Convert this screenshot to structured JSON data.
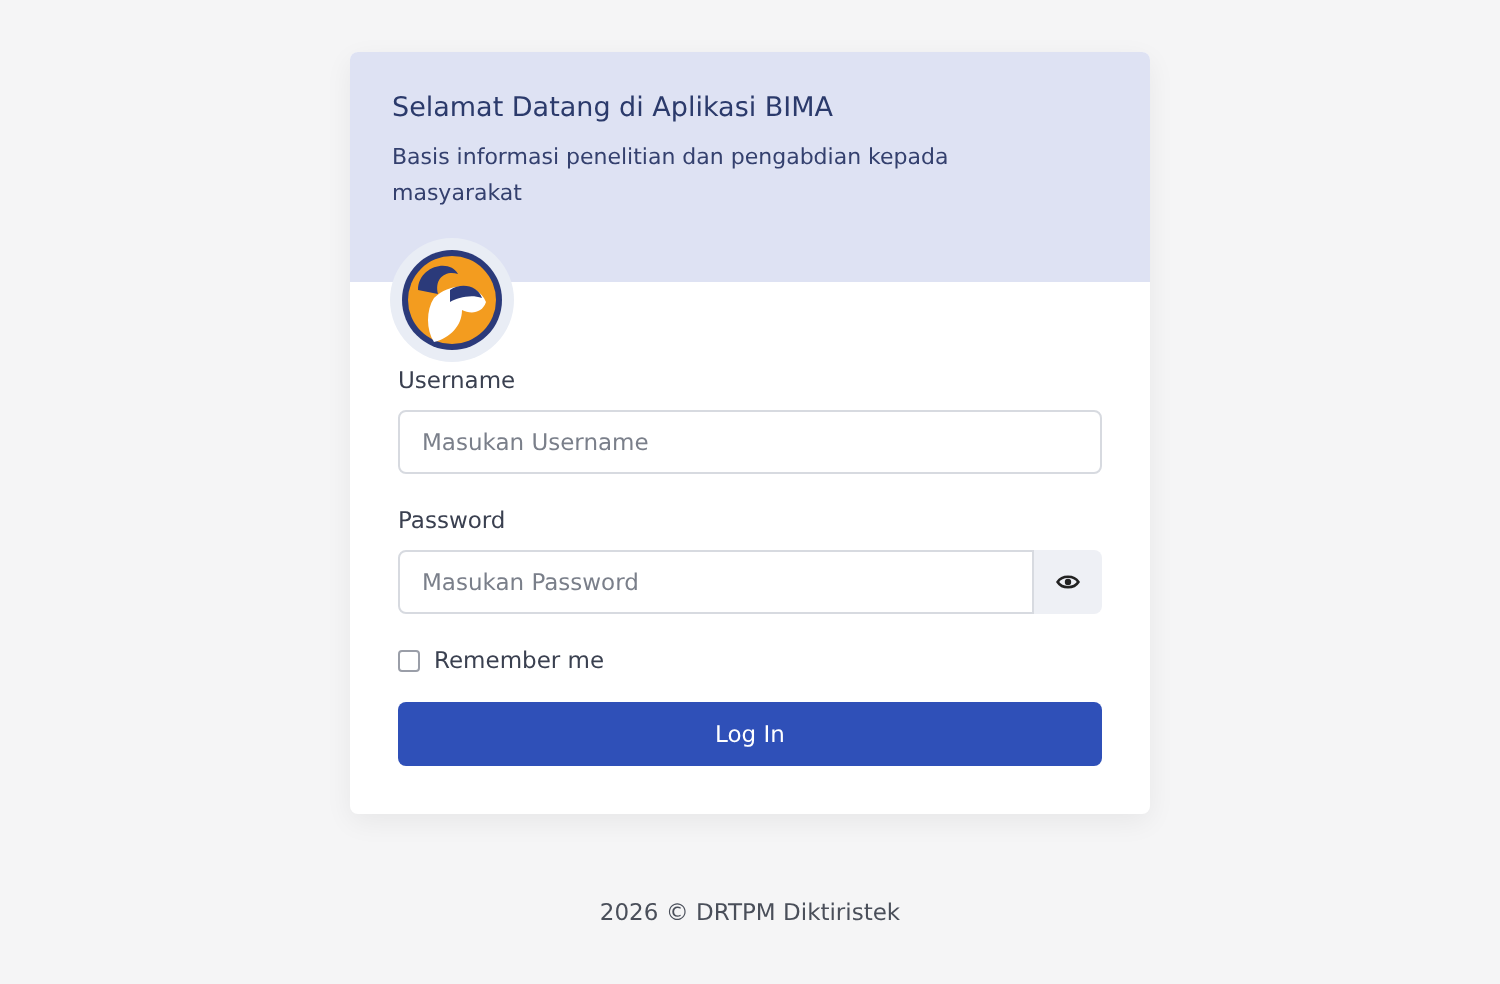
{
  "header": {
    "title": "Selamat Datang di Aplikasi BIMA",
    "subtitle": "Basis informasi penelitian dan pengabdian kepada masyarakat"
  },
  "form": {
    "username": {
      "label": "Username",
      "placeholder": "Masukan Username"
    },
    "password": {
      "label": "Password",
      "placeholder": "Masukan Password"
    },
    "remember": {
      "label": "Remember me",
      "checked": false
    },
    "submit": "Log In"
  },
  "footer": "2026 © DRTPM Diktiristek"
}
